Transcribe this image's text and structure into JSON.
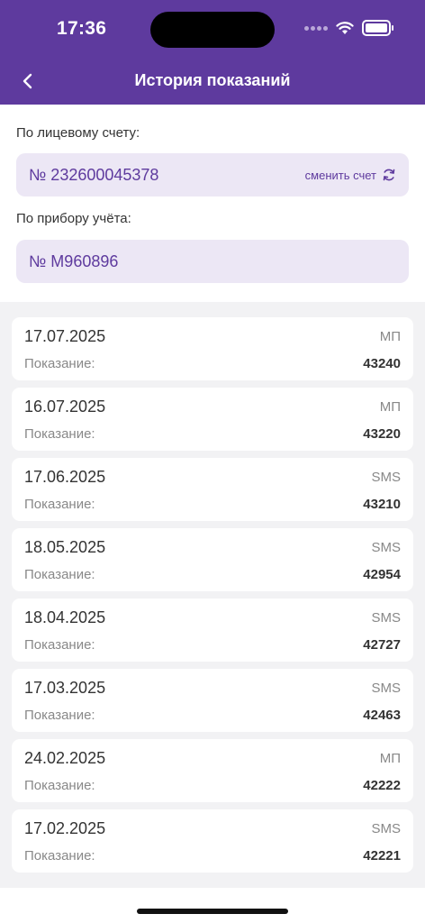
{
  "status": {
    "time": "17:36"
  },
  "header": {
    "title": "История показаний"
  },
  "account": {
    "label": "По лицевому счету:",
    "value": "№ 232600045378",
    "change_label": "сменить счет"
  },
  "meter": {
    "label": "По прибору учёта:",
    "value": "№ М960896"
  },
  "readings": [
    {
      "date": "17.07.2025",
      "source": "МП",
      "label": "Показание:",
      "value": "43240"
    },
    {
      "date": "16.07.2025",
      "source": "МП",
      "label": "Показание:",
      "value": "43220"
    },
    {
      "date": "17.06.2025",
      "source": "SMS",
      "label": "Показание:",
      "value": "43210"
    },
    {
      "date": "18.05.2025",
      "source": "SMS",
      "label": "Показание:",
      "value": "42954"
    },
    {
      "date": "18.04.2025",
      "source": "SMS",
      "label": "Показание:",
      "value": "42727"
    },
    {
      "date": "17.03.2025",
      "source": "SMS",
      "label": "Показание:",
      "value": "42463"
    },
    {
      "date": "24.02.2025",
      "source": "МП",
      "label": "Показание:",
      "value": "42222"
    },
    {
      "date": "17.02.2025",
      "source": "SMS",
      "label": "Показание:",
      "value": "42221"
    }
  ]
}
